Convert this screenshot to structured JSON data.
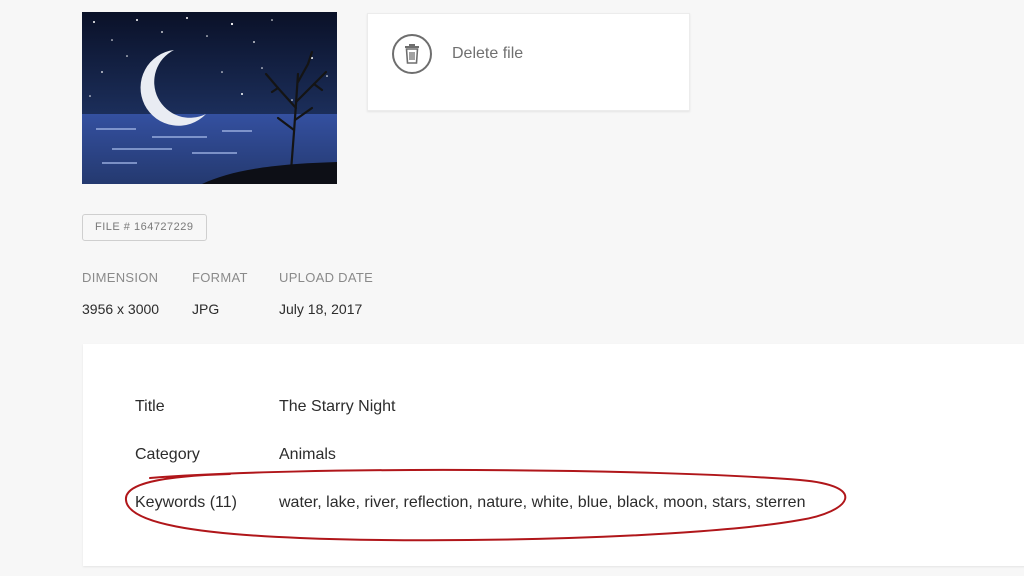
{
  "thumbnail": {
    "alt": "night lake with crescent moons and bare tree"
  },
  "actions": {
    "delete_label": "Delete file"
  },
  "file": {
    "badge": "FILE # 164727229"
  },
  "meta": {
    "dimension_label": "DIMENSION",
    "dimension_value": "3956 x 3000",
    "format_label": "FORMAT",
    "format_value": "JPG",
    "upload_label": "UPLOAD DATE",
    "upload_value": "July 18, 2017"
  },
  "details": {
    "title_label": "Title",
    "title_value": "The Starry Night",
    "category_label": "Category",
    "category_value": "Animals",
    "keywords_label": "Keywords (11)",
    "keywords_value": "water, lake, river, reflection, nature, white, blue, black, moon, stars, sterren"
  },
  "colors": {
    "page_bg": "#f7f7f7",
    "card_bg": "#ffffff",
    "annotation_red": "#b0161a",
    "muted_text": "#8a8a8a"
  },
  "icons": {
    "delete": "trash-icon"
  }
}
